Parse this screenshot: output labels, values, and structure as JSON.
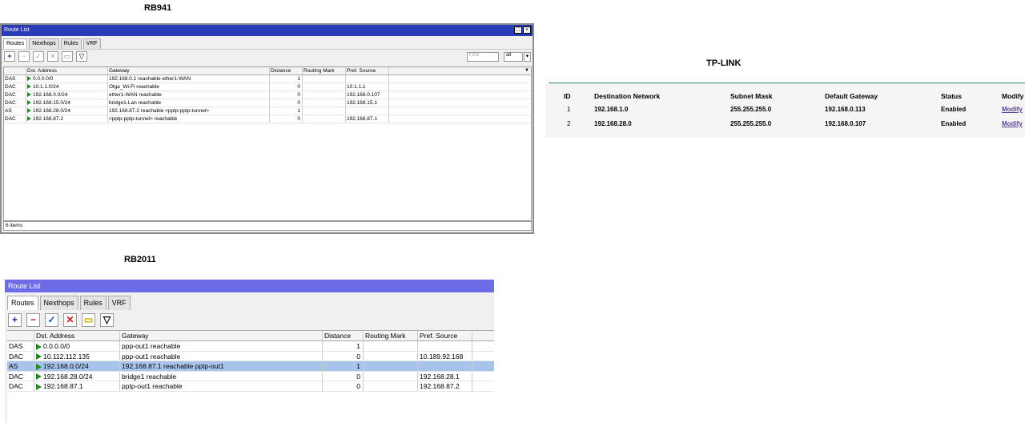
{
  "headings": {
    "rb941": "RB941",
    "tplink": "TP-LINK",
    "rb2011": "RB2011"
  },
  "rb941": {
    "title": "Route List",
    "tabs": [
      "Routes",
      "Nexthops",
      "Rules",
      "VRF"
    ],
    "find_placeholder": "Find",
    "filter_value": "all",
    "columns": [
      "",
      "Dst. Address",
      "Gateway",
      "Distance",
      "Routing Mark",
      "Pref. Source"
    ],
    "rows": [
      [
        "DAS",
        "0.0.0.0/0",
        "192.168.0.1 reachable ether1-WAN",
        "1",
        "",
        ""
      ],
      [
        "DAC",
        "10.1.1.0/24",
        "Olga_Wi-Fi reachable",
        "0",
        "",
        "10.1.1.1"
      ],
      [
        "DAC",
        "192.168.0.0/24",
        "ether1-WAN reachable",
        "0",
        "",
        "192.168.0.107"
      ],
      [
        "DAC",
        "192.168.15.0/24",
        "bridge1-Lan reachable",
        "0",
        "",
        "192.168.15.1"
      ],
      [
        "AS",
        "192.168.28.0/24",
        "192.168.87.2 reachable <pptp-pptp-tunnel>",
        "1",
        "",
        ""
      ],
      [
        "DAC",
        "192.168.87.2",
        "<pptp-pptp-tunnel> reachable",
        "0",
        "",
        "192.168.87.1"
      ]
    ],
    "status": "6 items"
  },
  "tplink": {
    "columns": [
      "ID",
      "Destination Network",
      "Subnet Mask",
      "Default Gateway",
      "Status",
      "Modify"
    ],
    "rows": [
      [
        "1",
        "192.168.1.0",
        "255.255.255.0",
        "192.168.0.113",
        "Enabled",
        "Modify"
      ],
      [
        "2",
        "192.168.28.0",
        "255.255.255.0",
        "192.168.0.107",
        "Enabled",
        "Modify"
      ]
    ]
  },
  "rb2011": {
    "title": "Route List",
    "tabs": [
      "Routes",
      "Nexthops",
      "Rules",
      "VRF"
    ],
    "columns": [
      "",
      "Dst. Address",
      "Gateway",
      "Distance",
      "Routing Mark",
      "Pref. Source"
    ],
    "rows": [
      [
        "DAS",
        "0.0.0.0/0",
        "ppp-out1 reachable",
        "1",
        "",
        ""
      ],
      [
        "DAC",
        "10.112.112.135",
        "ppp-out1 reachable",
        "0",
        "",
        "10.189.92.168"
      ],
      [
        "AS",
        "192.168.0.0/24",
        "192.168.87.1 reachable pptp-out1",
        "1",
        "",
        ""
      ],
      [
        "DAC",
        "192.168.28.0/24",
        "bridge1 reachable",
        "0",
        "",
        "192.168.28.1"
      ],
      [
        "DAC",
        "192.168.87.1",
        "pptp-out1 reachable",
        "0",
        "",
        "192.168.87.2"
      ]
    ],
    "selected_row": 2
  },
  "colors": {
    "rb941_title": "#2a3bb8",
    "rb2011_title": "#6d6be8",
    "selected_row": "#a8c4ea",
    "flag": "#1e8a1e",
    "tplink_link": "#5a3e93"
  }
}
